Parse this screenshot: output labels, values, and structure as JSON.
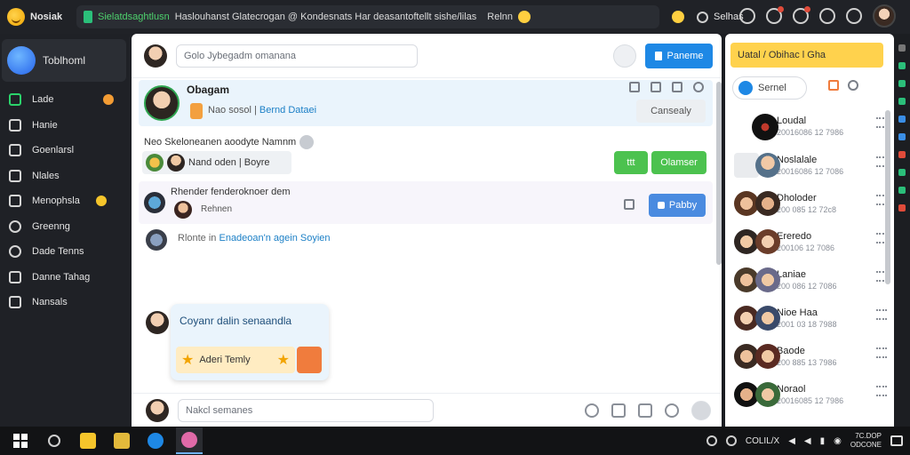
{
  "app": {
    "name": "Nosiak",
    "tab_title_a": "Sielatdsaghtlusn",
    "tab_title_b": "Haslouhanst Glatecrogan @ Kondesnats Har deasantoftellt sishe/lilas",
    "tab_extra": "Relnn",
    "search_label": "Selhas"
  },
  "sidebar": {
    "profile_name": "Toblhoml",
    "items": [
      {
        "label": "Lade",
        "icon": "inbox-icon"
      },
      {
        "label": "Hanie",
        "icon": "pencil-icon"
      },
      {
        "label": "Goenlarsl",
        "icon": "bookmark-icon"
      },
      {
        "label": "Nlales",
        "icon": "bookmark-outline-icon"
      },
      {
        "label": "Menophsla",
        "icon": "star-icon"
      },
      {
        "label": "Greenng",
        "icon": "clock-icon"
      },
      {
        "label": "Dade Tenns",
        "icon": "phone-icon"
      },
      {
        "label": "Danne Tahag",
        "icon": "check-icon"
      },
      {
        "label": "Nansals",
        "icon": "home-icon"
      }
    ]
  },
  "composer_top": {
    "placeholder": "Golo Jybegadm omanana",
    "button": "Paneme"
  },
  "post1": {
    "name": "Obagam",
    "sub_a": "Nao sosol",
    "sub_b": "Bernd Dataei",
    "action": "Cansealy"
  },
  "post2": {
    "text": "Neo Skeloneanen aoodyte Namnm",
    "chip": "Nand oden | Boyre",
    "btn_icon": "ttt",
    "btn_label": "Olamser"
  },
  "post3": {
    "text": "Rhender fenderoknoer dem",
    "sub": "Rehnen",
    "button": "Pabby"
  },
  "post4": {
    "prefix": "Rlonte in",
    "blue": "Enadeoan'n agein Soyien"
  },
  "card": {
    "title": "Coyanr dalin senaandla",
    "chip": "Aderi Temly"
  },
  "composer_bottom": {
    "placeholder": "Nakcl semanes"
  },
  "right": {
    "banner": "Uatal / Obihac l Gha",
    "search": "Sernel",
    "contacts": [
      {
        "name": "Loudal",
        "time": "20016086 12 7986"
      },
      {
        "name": "Noslalale",
        "time": "20016086 12 7086"
      },
      {
        "name": "Dholoder",
        "time": "200 085 12 72c8"
      },
      {
        "name": "Ereredo",
        "time": "200106 12 7086"
      },
      {
        "name": "Laniae",
        "time": "200 086 12 7086"
      },
      {
        "name": "Nioe Haa",
        "time": "2001 03 18 7988"
      },
      {
        "name": "Baode",
        "time": "200 885 13 7986"
      },
      {
        "name": "Noraol",
        "time": "20016085 12 7986"
      }
    ]
  },
  "taskbar": {
    "status": "COLIL/X",
    "clock_a": "7C.DOP",
    "clock_b": "ODCONE"
  },
  "colors": {
    "accent": "#1e88e5",
    "green": "#4cc24f",
    "yellow": "#ffd24d",
    "orange": "#f07c3d"
  }
}
